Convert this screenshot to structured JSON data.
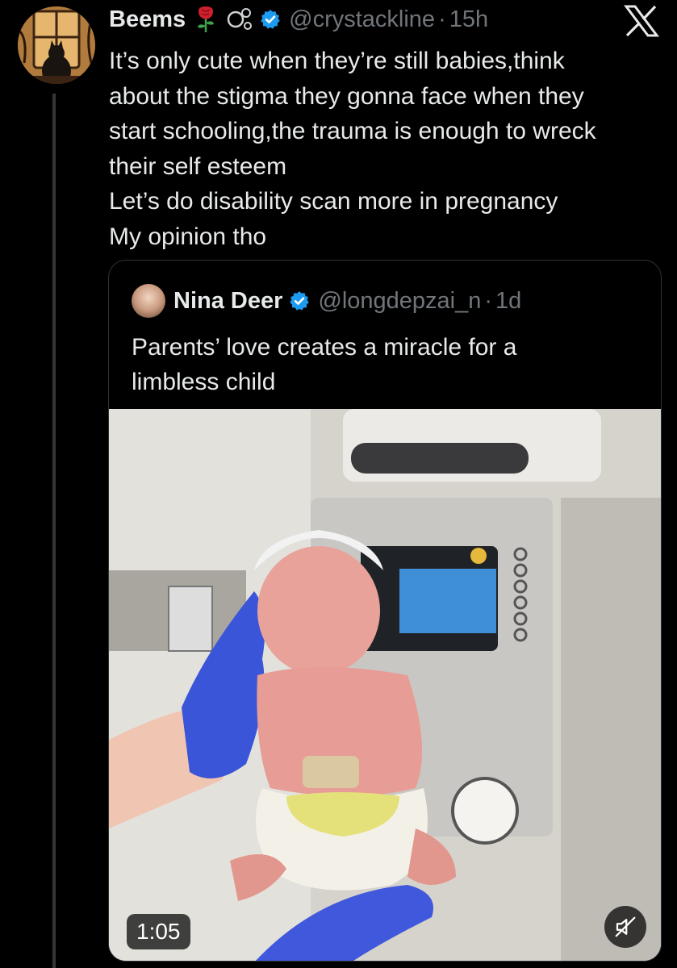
{
  "tweet": {
    "author_name": "Beems",
    "handle": "@crystackline",
    "separator": "·",
    "time": "15h",
    "lines": [
      "It’s only cute when they’re still babies,think",
      "about the stigma they gonna face when they",
      "start schooling,the trauma is enough to wreck",
      "their self esteem",
      "Let’s do disability scan more in pregnancy",
      "My opinion tho"
    ]
  },
  "quoted_tweet": {
    "author_name": "Nina Deer",
    "handle": "@longdepzai_n",
    "separator": "·",
    "time": "1d",
    "lines": [
      "Parents’ love creates a miracle for a",
      "limbless child"
    ],
    "video": {
      "duration": "1:05",
      "icon": "mute-icon"
    }
  },
  "colors": {
    "background": "#000000",
    "text": "#e7e9ea",
    "secondary_text": "#71767b",
    "verified": "#1d9bf0",
    "border": "#2f3336"
  }
}
